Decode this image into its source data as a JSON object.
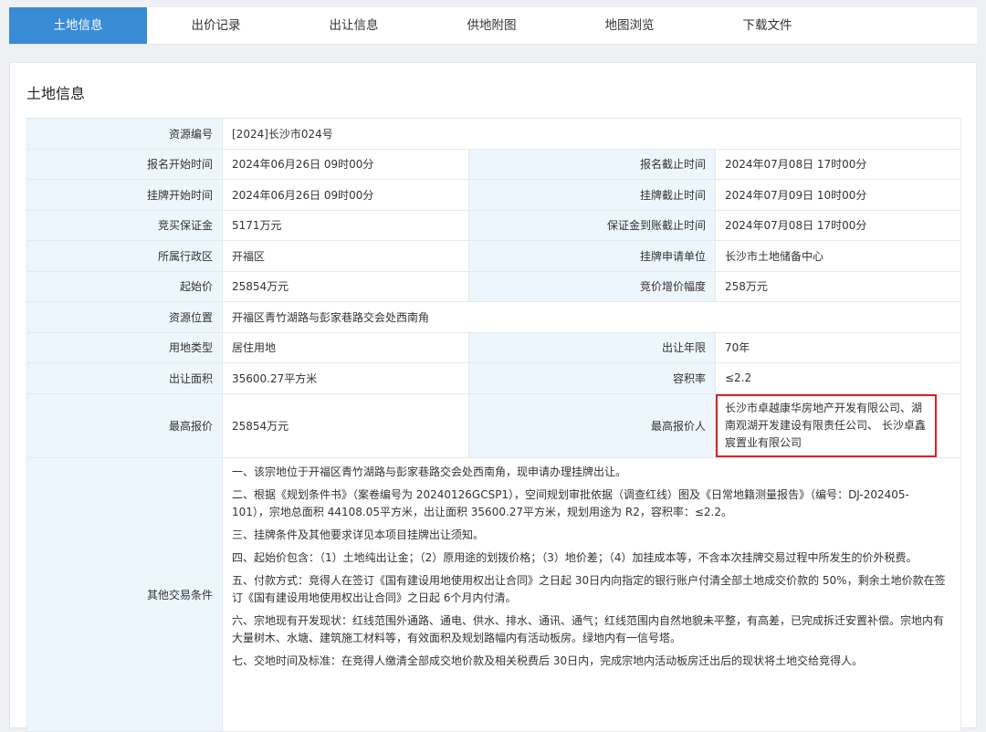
{
  "tabs": [
    "土地信息",
    "出价记录",
    "出让信息",
    "供地附图",
    "地图浏览",
    "下载文件"
  ],
  "panel_title": "土地信息",
  "rows": {
    "resource_no": {
      "label": "资源编号",
      "value": "[2024]长沙市024号"
    },
    "signup_start": {
      "label": "报名开始时间",
      "value": "2024年06月26日 09时00分"
    },
    "signup_end": {
      "label": "报名截止时间",
      "value": "2024年07月08日 17时00分"
    },
    "listing_start": {
      "label": "挂牌开始时间",
      "value": "2024年06月26日 09时00分"
    },
    "listing_end": {
      "label": "挂牌截止时间",
      "value": "2024年07月09日 10时00分"
    },
    "deposit": {
      "label": "竞买保证金",
      "value": "5171万元"
    },
    "deposit_deadline": {
      "label": "保证金到账截止时间",
      "value": "2024年07月08日 17时00分"
    },
    "district": {
      "label": "所属行政区",
      "value": "开福区"
    },
    "applicant_unit": {
      "label": "挂牌申请单位",
      "value": "长沙市土地储备中心"
    },
    "start_price": {
      "label": "起始价",
      "value": "25854万元"
    },
    "increment": {
      "label": "竞价增价幅度",
      "value": "258万元"
    },
    "location": {
      "label": "资源位置",
      "value": "开福区青竹湖路与彭家巷路交会处西南角"
    },
    "land_use": {
      "label": "用地类型",
      "value": "居住用地"
    },
    "term": {
      "label": "出让年限",
      "value": "70年"
    },
    "area": {
      "label": "出让面积",
      "value": "35600.27平方米"
    },
    "far": {
      "label": "容积率",
      "value": "≤2.2"
    },
    "top_price": {
      "label": "最高报价",
      "value": "25854万元"
    },
    "top_bidder": {
      "label": "最高报价人",
      "value": "长沙市卓越康华房地产开发有限公司、湖南观湖开发建设有限责任公司、 长沙卓鑫宸置业有限公司"
    },
    "other": {
      "label": "其他交易条件"
    }
  },
  "conditions": [
    "一、该宗地位于开福区青竹湖路与彭家巷路交会处西南角，现申请办理挂牌出让。",
    "二、根据《规划条件书》（案卷编号为 20240126GCSP1），空间规划审批依据（调查红线）图及《日常地籍测量报告》（编号：DJ-202405-101），宗地总面积 44108.05平方米，出让面积 35600.27平方米，规划用途为 R2，容积率：≤2.2。",
    "三、挂牌条件及其他要求详见本项目挂牌出让须知。",
    "四、起始价包含：（1）土地纯出让金；（2）原用途的划拨价格；（3）地价差；（4）加挂成本等，不含本次挂牌交易过程中所发生的价外税费。",
    "五、付款方式：竞得人在签订《国有建设用地使用权出让合同》之日起 30日内向指定的银行账户付清全部土地成交价款的 50%，剩余土地价款在签订《国有建设用地使用权出让合同》之日起 6个月内付清。",
    "六、宗地现有开发现状：红线范围外通路、通电、供水、排水、通讯、通气；红线范围内自然地貌未平整，有高差，已完成拆迁安置补偿。宗地内有大量树木、水塘、建筑施工材料等，有效面积及规划路幅内有活动板房。绿地内有一信号塔。",
    "七、交地时间及标准：在竞得人缴清全部成交地价款及相关税费后 30日内，完成宗地内活动板房迁出后的现状将土地交给竞得人。"
  ],
  "colors": {
    "accent": "#3a8bd6",
    "label_bg": "#eef6fd",
    "highlight": "#e02020"
  }
}
